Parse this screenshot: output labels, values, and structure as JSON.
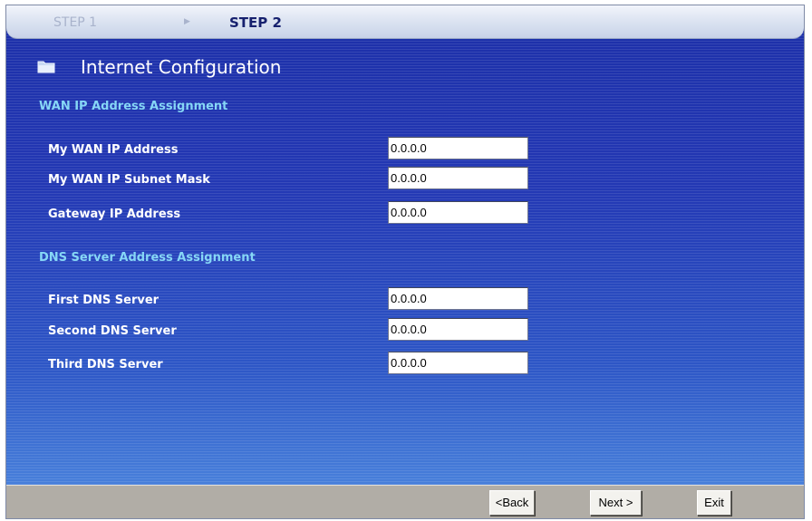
{
  "steps": {
    "step1_label": "STEP 1",
    "step2_label": "STEP 2",
    "separator_icon": "triangle-right-icon"
  },
  "page": {
    "title": "Internet Configuration",
    "title_icon": "folder-icon"
  },
  "wan_section": {
    "title": "WAN IP Address Assignment",
    "fields": [
      {
        "label": "My WAN IP Address",
        "value": "0.0.0.0"
      },
      {
        "label": "My WAN IP Subnet Mask",
        "value": "0.0.0.0"
      },
      {
        "label": "Gateway IP Address",
        "value": "0.0.0.0"
      }
    ]
  },
  "dns_section": {
    "title": "DNS Server Address Assignment",
    "fields": [
      {
        "label": "First DNS Server",
        "value": "0.0.0.0"
      },
      {
        "label": "Second DNS Server",
        "value": "0.0.0.0"
      },
      {
        "label": "Third DNS Server",
        "value": "0.0.0.0"
      }
    ]
  },
  "footer": {
    "back_label": "<Back",
    "next_label": "Next >",
    "exit_label": "Exit"
  },
  "colors": {
    "section_title": "#86d7f6",
    "panel_blue": "#2338b4",
    "footer_gray": "#b1ada6"
  }
}
